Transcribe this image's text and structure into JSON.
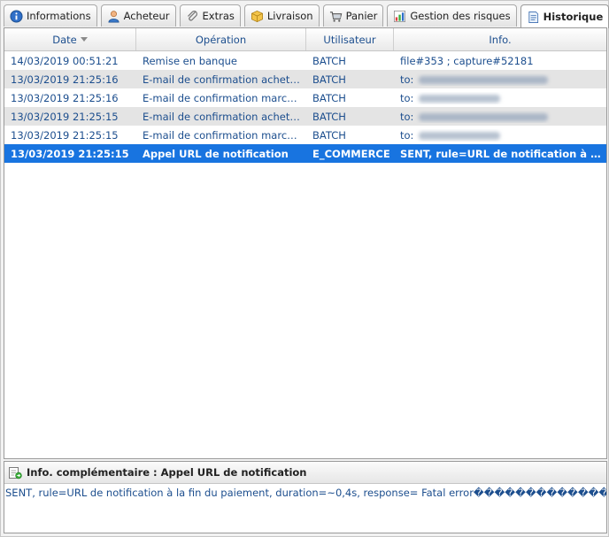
{
  "tabs": [
    {
      "label": "Informations",
      "icon": "info-icon",
      "active": false
    },
    {
      "label": "Acheteur",
      "icon": "user-icon",
      "active": false
    },
    {
      "label": "Extras",
      "icon": "paperclip-icon",
      "active": false
    },
    {
      "label": "Livraison",
      "icon": "package-icon",
      "active": false
    },
    {
      "label": "Panier",
      "icon": "cart-icon",
      "active": false
    },
    {
      "label": "Gestion des risques",
      "icon": "risk-icon",
      "active": false
    },
    {
      "label": "Historique",
      "icon": "history-icon",
      "active": true
    }
  ],
  "table": {
    "columns": [
      "Date",
      "Opération",
      "Utilisateur",
      "Info."
    ],
    "sorted_column": "Date",
    "rows": [
      {
        "date": "14/03/2019 00:51:21",
        "operation": "Remise en banque",
        "user": "BATCH",
        "info": "file#353 ; capture#52181",
        "redacted": false,
        "style": "plain"
      },
      {
        "date": "13/03/2019 21:25:16",
        "operation": "E-mail de confirmation acheteur",
        "user": "BATCH",
        "info": "to:",
        "redacted": true,
        "style": "alt"
      },
      {
        "date": "13/03/2019 21:25:16",
        "operation": "E-mail de confirmation marchand",
        "user": "BATCH",
        "info": "to:",
        "redacted": true,
        "style": "plain"
      },
      {
        "date": "13/03/2019 21:25:15",
        "operation": "E-mail de confirmation acheteur",
        "user": "BATCH",
        "info": "to:",
        "redacted": true,
        "style": "alt"
      },
      {
        "date": "13/03/2019 21:25:15",
        "operation": "E-mail de confirmation marchand",
        "user": "BATCH",
        "info": "to:",
        "redacted": true,
        "style": "plain"
      },
      {
        "date": "13/03/2019 21:25:15",
        "operation": "Appel URL de notification",
        "user": "E_COMMERCE",
        "info": "SENT, rule=URL de notification à la fin du paiement",
        "redacted": false,
        "style": "selected"
      }
    ]
  },
  "info_panel": {
    "title": "Info. complémentaire : Appel URL de notification",
    "body": "SENT, rule=URL de notification à la fin du paiement, duration=~0,4s, response= Fatal error������������������"
  },
  "colors": {
    "link_blue": "#1c4e8e",
    "selection": "#1874e0",
    "row_alt": "#e4e4e4"
  }
}
